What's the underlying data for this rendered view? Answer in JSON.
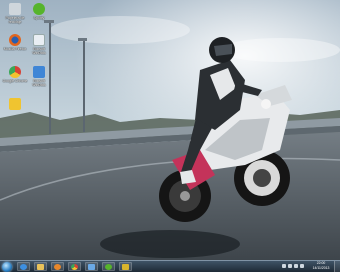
{
  "desktop": {
    "icons": [
      {
        "label": "Papelera de\nreciclaje",
        "icon": "recycle-bin-icon",
        "color": "#cfd6dc"
      },
      {
        "label": "Spotify",
        "icon": "spotify-icon",
        "color": "#56b42c"
      },
      {
        "label": "Mozilla Firefox",
        "icon": "firefox-icon",
        "color": "#e2661f"
      },
      {
        "label": "Rocsoft WinData",
        "icon": "windata-icon",
        "color": "#e9eef3"
      },
      {
        "label": "Google Chrome",
        "icon": "chrome-icon",
        "color": "#d64235"
      },
      {
        "label": "Rocsoft WinData",
        "icon": "windata-alt-icon",
        "color": "#3f86d6"
      },
      {
        "label": "",
        "icon": "folder-shortcut-icon",
        "color": "#f0c430"
      }
    ]
  },
  "taskbar": {
    "start": "start-orb-icon",
    "pinned": [
      {
        "icon": "internet-explorer-icon",
        "color": "#3d8fe0"
      },
      {
        "icon": "file-explorer-icon",
        "color": "#e8c25a"
      },
      {
        "icon": "media-player-icon",
        "color": "#e7872b"
      },
      {
        "icon": "chrome-taskbar-icon",
        "color": "#d64235"
      },
      {
        "icon": "control-panel-icon",
        "color": "#6aa9e6"
      },
      {
        "icon": "spotify-taskbar-icon",
        "color": "#56b42c"
      },
      {
        "icon": "winrar-icon",
        "color": "#d9b52c"
      }
    ],
    "clock_time": "22:00",
    "clock_date": "14/11/2013"
  }
}
